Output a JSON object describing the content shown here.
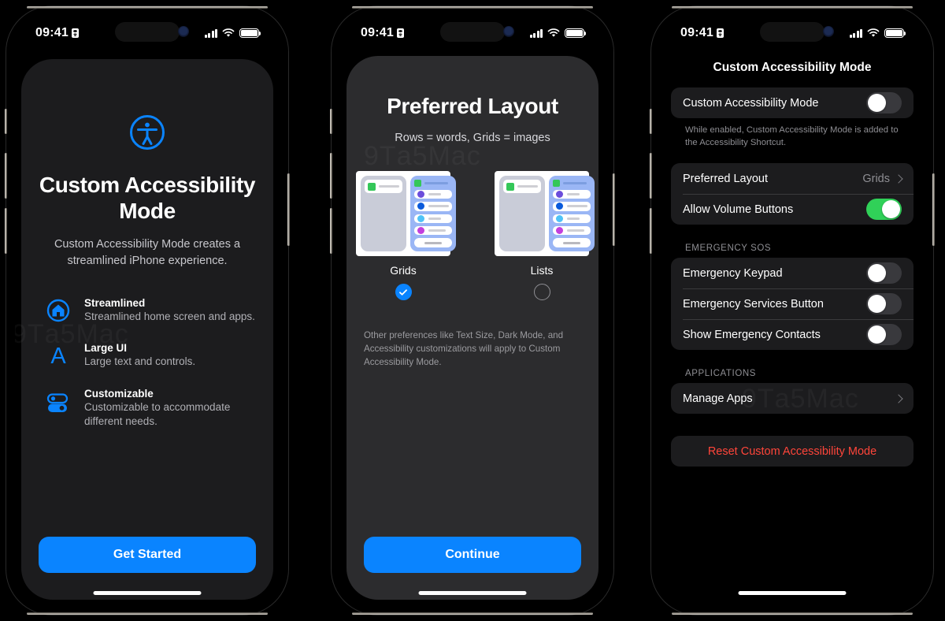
{
  "status_bar": {
    "time": "09:41",
    "lock_icon": "portrait-lock-icon",
    "signal_icon": "cellular-bars-icon",
    "wifi_icon": "wifi-icon",
    "battery_icon": "battery-full-icon"
  },
  "watermark": "9Tа5Mac",
  "phone1": {
    "hero_icon": "accessibility-icon",
    "title": "Custom Accessibility Mode",
    "subtitle": "Custom Accessibility Mode creates a streamlined iPhone experience.",
    "features": [
      {
        "icon": "home-circle-icon",
        "title": "Streamlined",
        "desc": "Streamlined home screen and apps."
      },
      {
        "icon": "large-text-a-icon",
        "title": "Large UI",
        "desc": "Large text and controls."
      },
      {
        "icon": "toggles-icon",
        "title": "Customizable",
        "desc": "Customizable to accommodate different needs."
      }
    ],
    "cta": "Get Started"
  },
  "phone2": {
    "title": "Preferred Layout",
    "subtitle": "Rows = words, Grids = images",
    "choices": [
      {
        "label": "Grids",
        "selected": true
      },
      {
        "label": "Lists",
        "selected": false
      }
    ],
    "note": "Other preferences like Text Size, Dark Mode, and Accessibility customizations will apply to Custom Accessibility Mode.",
    "cta": "Continue"
  },
  "phone3": {
    "nav_title": "Custom Accessibility Mode",
    "main_row": {
      "label": "Custom Accessibility Mode",
      "toggle": "off"
    },
    "main_footnote": "While enabled, Custom Accessibility Mode is added to the Accessibility Shortcut.",
    "options": [
      {
        "label": "Preferred Layout",
        "value": "Grids",
        "type": "link"
      },
      {
        "label": "Allow Volume Buttons",
        "type": "toggle",
        "toggle": "on"
      }
    ],
    "sos_header": "EMERGENCY SOS",
    "sos_rows": [
      {
        "label": "Emergency Keypad",
        "toggle": "off"
      },
      {
        "label": "Emergency Services Button",
        "toggle": "off"
      },
      {
        "label": "Show Emergency Contacts",
        "toggle": "off"
      }
    ],
    "apps_header": "APPLICATIONS",
    "apps_row": {
      "label": "Manage Apps"
    },
    "reset_label": "Reset Custom Accessibility Mode"
  },
  "colors": {
    "accent_blue": "#0a84ff",
    "toggle_green": "#30d158",
    "destructive_red": "#ff453a",
    "card_dark": "#1c1c1e",
    "sheet_dark": "#2c2c2e"
  }
}
